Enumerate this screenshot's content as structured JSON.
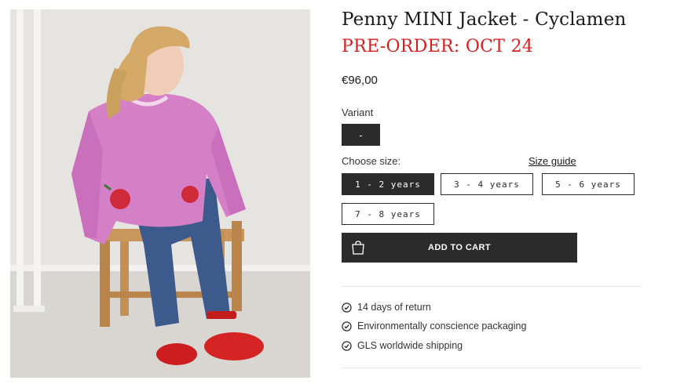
{
  "product": {
    "title": "Penny MINI Jacket - Cyclamen",
    "preorder": "PRE-ORDER: OCT 24",
    "price": "€96,00"
  },
  "variant": {
    "label": "Variant",
    "selected": "-"
  },
  "size": {
    "label": "Choose size:",
    "guide_link": "Size guide",
    "options": [
      "1 - 2 years",
      "3 - 4 years",
      "5 - 6 years",
      "7 - 8 years"
    ],
    "selected": "1 - 2 years"
  },
  "cart": {
    "button_label": "ADD TO CART",
    "icon": "shopping-bag-icon"
  },
  "perks": [
    {
      "icon": "check-circle-icon",
      "text": "14 days of return"
    },
    {
      "icon": "check-circle-icon",
      "text": "Environmentally conscience packaging"
    },
    {
      "icon": "check-circle-icon",
      "text": "GLS worldwide shipping"
    }
  ],
  "colors": {
    "accent_red": "#d81f1f",
    "dark": "#2b2b2b"
  }
}
